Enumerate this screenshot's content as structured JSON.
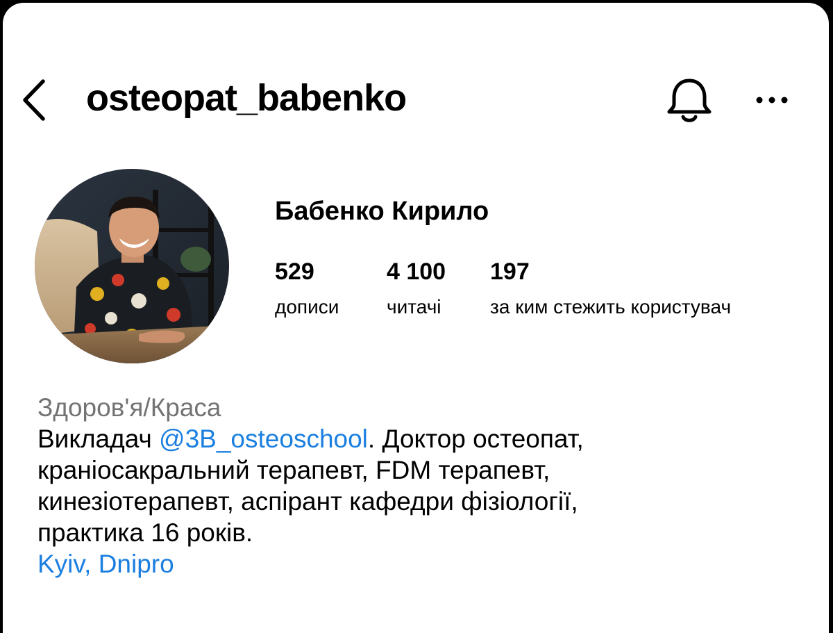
{
  "header": {
    "username": "osteopat_babenko",
    "back_icon": "chevron-left-icon",
    "bell_icon": "bell-icon",
    "more_icon": "more-horizontal-icon"
  },
  "profile": {
    "full_name": "Бабенко Кирило",
    "stats": [
      {
        "value": "529",
        "label": "дописи"
      },
      {
        "value": "4 100",
        "label": "читачі"
      },
      {
        "value": "197",
        "label": "за ким стежить користувач"
      }
    ]
  },
  "bio": {
    "category": "Здоров'я/Краса",
    "line1_prefix": "Викладач ",
    "mention": "@3B_osteoschool",
    "line1_suffix": ". Доктор остеопат,",
    "line2": "краніосакральний терапевт, FDM терапевт,",
    "line3": "кинезіотерапевт, аспірант кафедри фізіології,",
    "line4": "практика 16 років.",
    "location_link": "Kyiv, Dnipro"
  },
  "colors": {
    "link": "#1b7fe0",
    "category": "#737373",
    "text": "#000000",
    "background": "#ffffff"
  }
}
